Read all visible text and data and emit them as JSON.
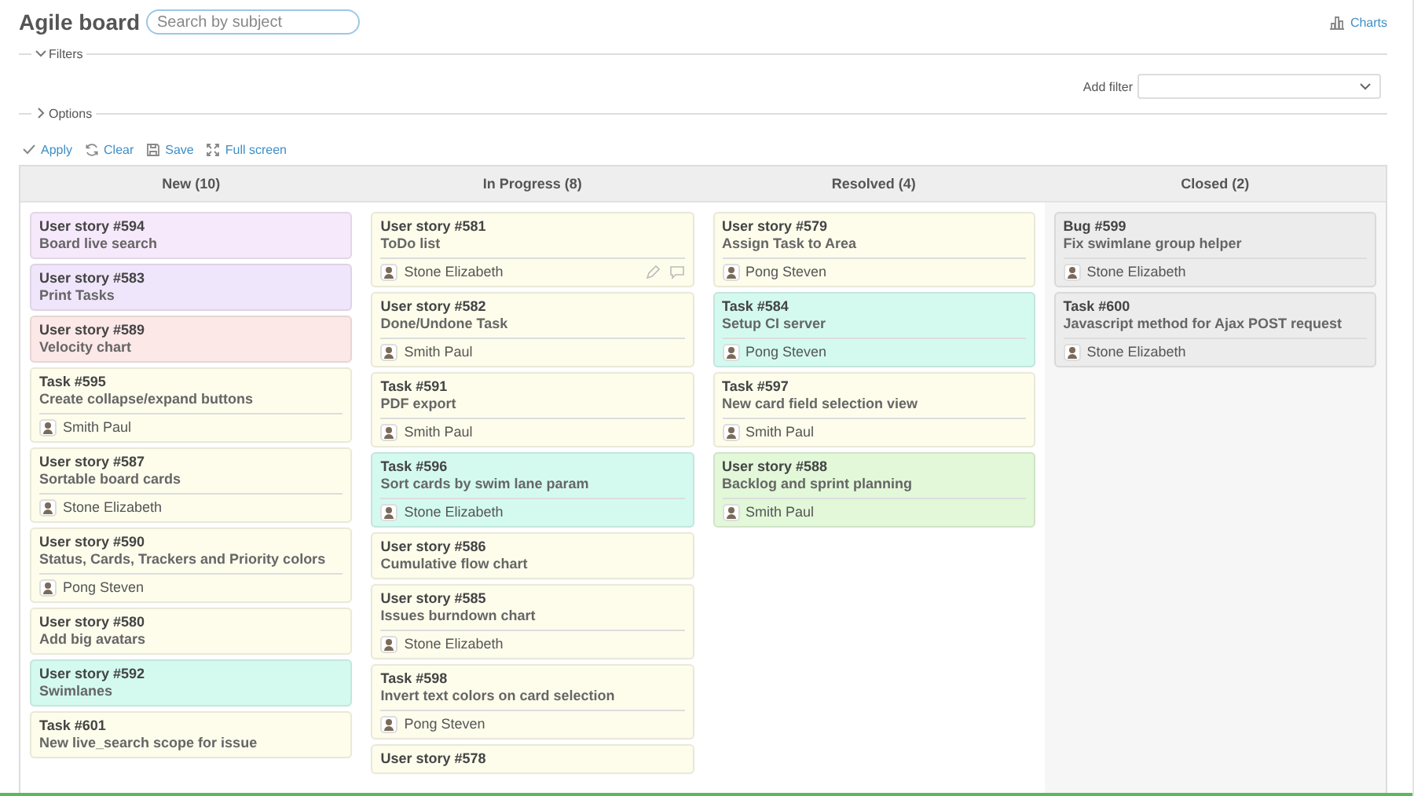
{
  "title": "Agile board",
  "search": {
    "placeholder": "Search by subject"
  },
  "charts_link": "Charts",
  "filters": {
    "label": "Filters",
    "expanded": true,
    "add_filter_label": "Add filter"
  },
  "options": {
    "label": "Options",
    "expanded": false
  },
  "actions": [
    "Apply",
    "Clear",
    "Save",
    "Full screen"
  ],
  "columns": [
    {
      "title": "New (10)",
      "cards": [
        {
          "id": "User story #594",
          "subject": "Board live search",
          "color": "#f6e9fb"
        },
        {
          "id": "User story #583",
          "subject": "Print Tasks",
          "color": "#f0e6fb"
        },
        {
          "id": "User story #589",
          "subject": "Velocity chart",
          "color": "#fde8e8"
        },
        {
          "id": "Task #595",
          "subject": "Create collapse/expand buttons",
          "color": "#fefdec",
          "assignee": "Smith Paul"
        },
        {
          "id": "User story #587",
          "subject": "Sortable board cards",
          "color": "#fefdec",
          "assignee": "Stone Elizabeth"
        },
        {
          "id": "User story #590",
          "subject": "Status, Cards, Trackers and Priority colors",
          "color": "#fefdec",
          "assignee": "Pong Steven"
        },
        {
          "id": "User story #580",
          "subject": "Add big avatars",
          "color": "#fefdec"
        },
        {
          "id": "User story #592",
          "subject": "Swimlanes",
          "color": "#d4faf0"
        },
        {
          "id": "Task #601",
          "subject": "New live_search scope for issue",
          "color": "#fefdec"
        }
      ]
    },
    {
      "title": "In Progress (8)",
      "cards": [
        {
          "id": "User story #581",
          "subject": "ToDo list",
          "color": "#fefdec",
          "assignee": "Stone Elizabeth",
          "hovered": true
        },
        {
          "id": "User story #582",
          "subject": "Done/Undone Task",
          "color": "#fefdec",
          "assignee": "Smith Paul"
        },
        {
          "id": "Task #591",
          "subject": "PDF export",
          "color": "#fefdec",
          "assignee": "Smith Paul"
        },
        {
          "id": "Task #596",
          "subject": "Sort cards by swim lane param",
          "color": "#d4faf0",
          "assignee": "Stone Elizabeth"
        },
        {
          "id": "User story #586",
          "subject": "Cumulative flow chart",
          "color": "#fefdec"
        },
        {
          "id": "User story #585",
          "subject": "Issues burndown chart",
          "color": "#fefdec",
          "assignee": "Stone Elizabeth"
        },
        {
          "id": "Task #598",
          "subject": "Invert text colors on card selection",
          "color": "#fefdec",
          "assignee": "Pong Steven"
        },
        {
          "id": "User story #578",
          "color": "#fefdec"
        }
      ]
    },
    {
      "title": "Resolved (4)",
      "cards": [
        {
          "id": "User story #579",
          "subject": "Assign Task to Area",
          "color": "#fefdec",
          "assignee": "Pong Steven"
        },
        {
          "id": "Task #584",
          "subject": "Setup CI server",
          "color": "#d4faf0",
          "assignee": "Pong Steven"
        },
        {
          "id": "Task #597",
          "subject": "New card field selection view",
          "color": "#fefdec",
          "assignee": "Smith Paul"
        },
        {
          "id": "User story #588",
          "subject": "Backlog and sprint planning",
          "color": "#e2f8d9",
          "assignee": "Smith Paul"
        }
      ]
    },
    {
      "title": "Closed (2)",
      "cards": [
        {
          "id": "Bug #599",
          "subject": "Fix swimlane group helper",
          "color": "#ececec",
          "assignee": "Stone Elizabeth"
        },
        {
          "id": "Task #600",
          "subject": "Javascript method for Ajax POST request",
          "color": "#ececec",
          "assignee": "Stone Elizabeth"
        }
      ]
    }
  ]
}
